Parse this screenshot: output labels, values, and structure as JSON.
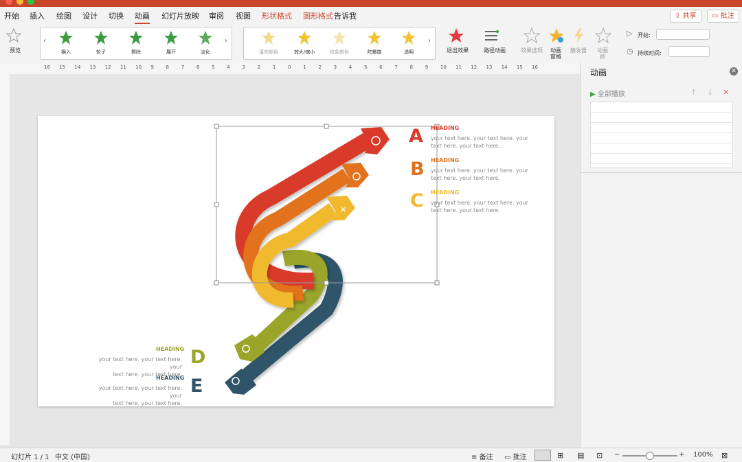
{
  "tabs": [
    "开始",
    "插入",
    "绘图",
    "设计",
    "切换",
    "动画",
    "幻灯片放映",
    "审阅",
    "视图",
    "形状格式",
    "图形格式",
    "告诉我"
  ],
  "top_buttons": {
    "share": "共享",
    "comment": "批注"
  },
  "ribbon": {
    "preview": "预览",
    "enter_effects": [
      "横入",
      "轮子",
      "擦除",
      "展开",
      "淡化"
    ],
    "emphasis_effects": [
      "填充颜色",
      "放大/缩小",
      "线条颜色",
      "陀螺旋",
      "透明"
    ],
    "exit": "退出效果",
    "path": "路径动画",
    "effect_options": "效果选项",
    "anim_pane": [
      "动画",
      "窗格"
    ],
    "trigger": "触发器",
    "anim_painter": [
      "动画",
      "刷"
    ],
    "start": "开始:",
    "duration": "持续时间:"
  },
  "ruler": {
    "ticks": [
      "16",
      "15",
      "14",
      "13",
      "12",
      "11",
      "10",
      "9",
      "8",
      "7",
      "6",
      "5",
      "4",
      "3",
      "2",
      "1",
      "0",
      "1",
      "2",
      "3",
      "4",
      "5",
      "6",
      "7",
      "8",
      "9",
      "10",
      "11",
      "12",
      "13",
      "14",
      "15",
      "16"
    ]
  },
  "slide": {
    "items": [
      {
        "letter": "A",
        "heading": "HEADING",
        "line1": "your text here. your text here. your",
        "line2": "text here. your text here.",
        "color": "#d93a2b"
      },
      {
        "letter": "B",
        "heading": "HEADING",
        "line1": "your text here. your text here. your",
        "line2": "text here. your text here.",
        "color": "#e2731e"
      },
      {
        "letter": "C",
        "heading": "HEADING",
        "line1": "your text here. your text here. your",
        "line2": "text here. your text here.",
        "color": "#f0b92f"
      },
      {
        "letter": "D",
        "heading": "HEADING",
        "line1": "your text here. your text here. your",
        "line2": "text here. your text here.",
        "color": "#9aa52a"
      },
      {
        "letter": "E",
        "heading": "HEADING",
        "line1": "your text here. your text here. your",
        "line2": "text here. your text here.",
        "color": "#2f5469"
      }
    ]
  },
  "pane": {
    "title": "动画",
    "play_all": "全部播放"
  },
  "status": {
    "slide": "幻灯片 1 / 1",
    "lang": "中文 (中国)",
    "notes": "备注",
    "comments": "批注",
    "zoom": "100%"
  }
}
